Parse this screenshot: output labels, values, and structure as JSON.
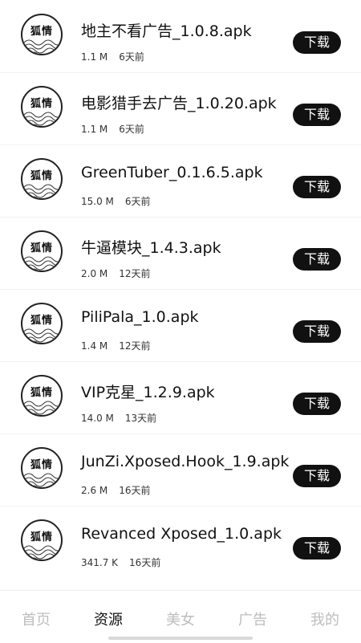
{
  "avatar_text": "狐情",
  "download_label": "下载",
  "items": [
    {
      "name": "地主不看广告_1.0.8.apk",
      "size": "1.1 M",
      "time": "6天前"
    },
    {
      "name": "电影猎手去广告_1.0.20.apk",
      "size": "1.1 M",
      "time": "6天前"
    },
    {
      "name": "GreenTuber_0.1.6.5.apk",
      "size": "15.0 M",
      "time": "6天前"
    },
    {
      "name": "牛逼模块_1.4.3.apk",
      "size": "2.0 M",
      "time": "12天前"
    },
    {
      "name": "PiliPala_1.0.apk",
      "size": "1.4 M",
      "time": "12天前"
    },
    {
      "name": "VIP克星_1.2.9.apk",
      "size": "14.0 M",
      "time": "13天前"
    },
    {
      "name": "JunZi.Xposed.Hook_1.9.apk",
      "size": "2.6 M",
      "time": "16天前"
    },
    {
      "name": "Revanced Xposed_1.0.apk",
      "size": "341.7 K",
      "time": "16天前"
    }
  ],
  "tabs": [
    {
      "label": "首页",
      "active": false
    },
    {
      "label": "资源",
      "active": true
    },
    {
      "label": "美女",
      "active": false
    },
    {
      "label": "广告",
      "active": false
    },
    {
      "label": "我的",
      "active": false
    }
  ]
}
